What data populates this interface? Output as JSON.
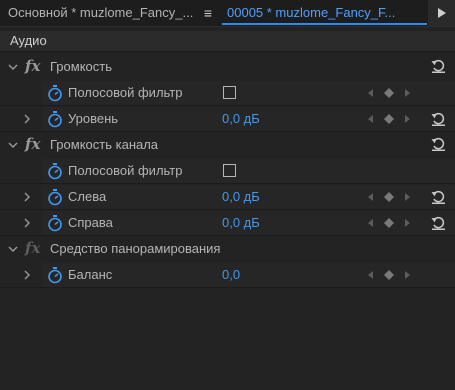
{
  "tabs": [
    {
      "label": "Основной * muzlome_Fancy_...",
      "active": false
    },
    {
      "label": "00005 * muzlome_Fancy_F...",
      "active": true
    }
  ],
  "tab_menu_icon": "double-chevron-right-icon",
  "tab_overflow_icon": "triangle-right-icon",
  "section": {
    "title": "Аудио"
  },
  "effects": [
    {
      "label": "Громкость",
      "expanded": true,
      "properties": [
        {
          "label": "Полосовой фильтр",
          "type": "checkbox",
          "checked": false
        },
        {
          "label": "Уровень",
          "type": "value",
          "value": "0,0 дБ"
        }
      ]
    },
    {
      "label": "Громкость канала",
      "expanded": true,
      "properties": [
        {
          "label": "Полосовой фильтр",
          "type": "checkbox",
          "checked": false
        },
        {
          "label": "Слева",
          "type": "value",
          "value": "0,0 дБ"
        },
        {
          "label": "Справа",
          "type": "value",
          "value": "0,0 дБ"
        }
      ]
    },
    {
      "label": "Средство панорамирования",
      "expanded": true,
      "properties": [
        {
          "label": "Баланс",
          "type": "value",
          "value": "0,0"
        }
      ]
    }
  ],
  "colors": {
    "accent": "#3f98f2",
    "active_tab": "#4ea0ff",
    "background": "#232323",
    "text": "#b5b5b5"
  }
}
